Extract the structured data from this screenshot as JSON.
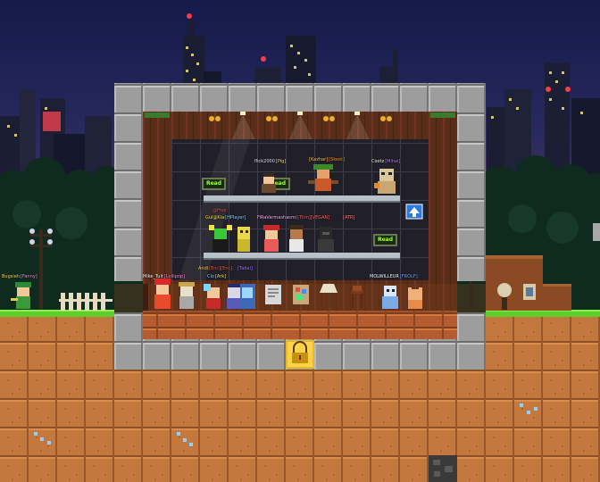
{
  "players": [
    {
      "name": "flick2000",
      "tag": "[Pig]",
      "name_color": "#e8e8ff",
      "tag_color": "#ffe24a"
    },
    {
      "name": "[Kazhar]",
      "tag": "[Skeet]",
      "name_color": "#ffd24a",
      "tag_color": "#ff9a2a"
    },
    {
      "name": "Cootz",
      "tag": "[Mihai]",
      "name_color": "#ffffff",
      "tag_color": "#c07aff"
    },
    {
      "name": "@Hizz",
      "tag": "",
      "name_color": "#ff5a5a",
      "tag_color": "#ffffff"
    },
    {
      "name": "Gul@Kia",
      "tag": "[HPlayer]",
      "name_color": "#ffe24a",
      "tag_color": "#9ad8ff"
    },
    {
      "name": "FiRaVarmashasmi",
      "tag": "[Thin][VEGAN]",
      "name_color": "#ffb0ff",
      "tag_color": "#ff6a6a"
    },
    {
      "name": "[ATR]",
      "tag": "",
      "name_color": "#ff8a8a",
      "tag_color": "#ffffff"
    },
    {
      "name": "Andi",
      "tag": "[Enc][Enc]",
      "name_color": "#ffe24a",
      "tag_color": "#ff5a5a"
    },
    {
      "name": "[Tadal]",
      "tag": "",
      "name_color": "#b07aff",
      "tag_color": "#ffffff"
    },
    {
      "name": "Mike_Tuit",
      "tag": "[Lollipop]",
      "name_color": "#ffffff",
      "tag_color": "#ff9ad8"
    },
    {
      "name": "Clo",
      "tag": "[Ark]",
      "name_color": "#9ad8ff",
      "tag_color": "#ffe24a"
    },
    {
      "name": "MOLWILLEUR",
      "tag": "[FROLF]",
      "name_color": "#ffffff",
      "tag_color": "#7aaaff"
    },
    {
      "name": "Bugsiah",
      "tag": "[Fanny]",
      "name_color": "#ffe24a",
      "tag_color": "#ff9ad8"
    }
  ],
  "signs": [
    "Read",
    "Read",
    "Read"
  ],
  "scene": {
    "sky_top": "#141a4a",
    "sky_bottom": "#7a3a62",
    "dirt": "#c5783d",
    "stone": "#9a9a9a",
    "grass": "#5ecf2a",
    "wood_floor": "#b05a2e",
    "chat_button": "up-arrow-icon",
    "lock": "padlock-icon"
  }
}
